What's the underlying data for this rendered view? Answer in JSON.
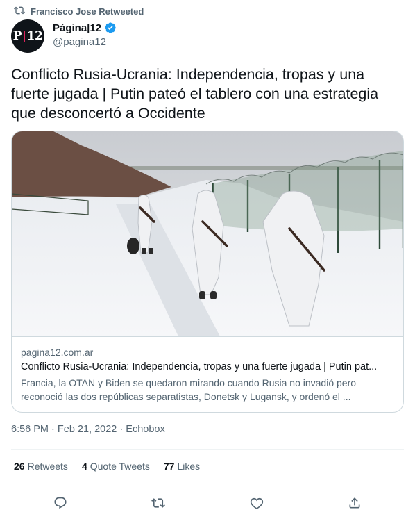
{
  "retweet": {
    "text": "Francisco Jose Retweeted"
  },
  "author": {
    "avatar_text_left": "P",
    "avatar_text_right": "12",
    "name": "Página|12",
    "handle": "@pagina12"
  },
  "tweet": {
    "text": "Conflicto Rusia-Ucrania: Independencia, tropas y una fuerte jugada | Putin pateó el tablero con una estrategia que desconcertó a Occidente"
  },
  "card": {
    "domain": "pagina12.com.ar",
    "title": "Conflicto Rusia-Ucrania: Independencia, tropas y una fuerte jugada | Putin pat...",
    "description": "Francia, la OTAN y Biden se quedaron mirando cuando Rusia no invadió pero reconoció las dos repúblicas separatistas, Donetsk y Lugansk, y ordenó el ..."
  },
  "meta": {
    "time": "6:56 PM",
    "date": "Feb 21, 2022",
    "source": "Echobox",
    "sep": "·"
  },
  "stats": {
    "retweets_count": "26",
    "retweets_label": "Retweets",
    "quotes_count": "4",
    "quotes_label": "Quote Tweets",
    "likes_count": "77",
    "likes_label": "Likes"
  },
  "colors": {
    "verified": "#1d9bf0",
    "secondary_text": "#536471",
    "border": "#cfd9de"
  },
  "icons": [
    "retweet-icon",
    "verified-icon",
    "reply-icon",
    "like-icon",
    "share-icon"
  ]
}
